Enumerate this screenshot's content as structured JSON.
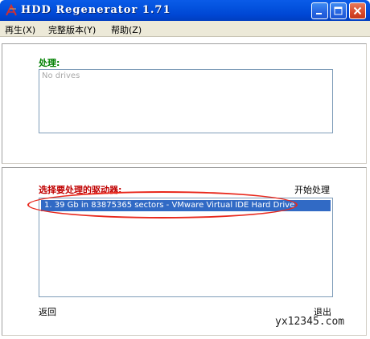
{
  "window": {
    "title": "HDD Regenerator 1.71"
  },
  "menu": {
    "items": [
      {
        "label": "再生(X)"
      },
      {
        "label": "完整版本(Y)"
      },
      {
        "label": "帮助(Z)"
      }
    ]
  },
  "processing": {
    "label": "处理:",
    "placeholder": "No drives"
  },
  "drive_selection": {
    "label": "选择要处理的驱动器:",
    "start_label": "开始处理",
    "drives": [
      {
        "text": "1. 39 Gb in 83875365 sectors  -  VMware Virtual IDE Hard Drive"
      }
    ]
  },
  "footer": {
    "back_label": "返回",
    "exit_label": "退出"
  },
  "watermark": "yx12345.com",
  "colors": {
    "title_bar": "#0454e0",
    "label_green": "#008000",
    "label_red": "#c00000",
    "selection": "#316ac5",
    "annotation_oval": "#e8281c"
  }
}
